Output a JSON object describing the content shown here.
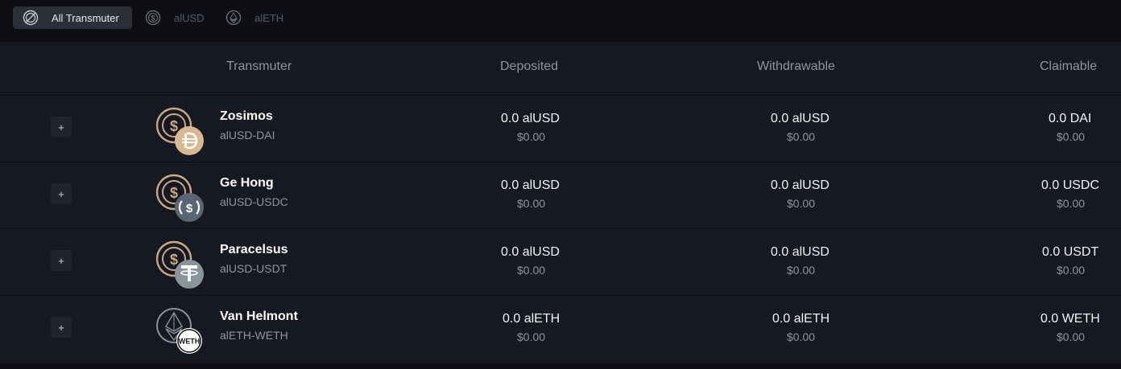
{
  "tabs": [
    {
      "label": "All Transmuter",
      "active": true,
      "icon": "transmuter-icon"
    },
    {
      "label": "alUSD",
      "active": false,
      "icon": "alusd-icon"
    },
    {
      "label": "alETH",
      "active": false,
      "icon": "aleth-icon"
    }
  ],
  "table": {
    "headers": {
      "transmuter": "Transmuter",
      "deposited": "Deposited",
      "withdrawable": "Withdrawable",
      "claimable": "Claimable"
    },
    "expand_label": "+",
    "rows": [
      {
        "name": "Zosimos",
        "pair": "alUSD-DAI",
        "deposited": "0.0 alUSD",
        "deposited_usd": "$0.00",
        "withdrawable": "0.0 alUSD",
        "withdrawable_usd": "$0.00",
        "claimable": "0.0 DAI",
        "claimable_usd": "$0.00",
        "token_icon": "dai-icon"
      },
      {
        "name": "Ge Hong",
        "pair": "alUSD-USDC",
        "deposited": "0.0 alUSD",
        "deposited_usd": "$0.00",
        "withdrawable": "0.0 alUSD",
        "withdrawable_usd": "$0.00",
        "claimable": "0.0 USDC",
        "claimable_usd": "$0.00",
        "token_icon": "usdc-icon"
      },
      {
        "name": "Paracelsus",
        "pair": "alUSD-USDT",
        "deposited": "0.0 alUSD",
        "deposited_usd": "$0.00",
        "withdrawable": "0.0 alUSD",
        "withdrawable_usd": "$0.00",
        "claimable": "0.0 USDT",
        "claimable_usd": "$0.00",
        "token_icon": "usdt-icon"
      },
      {
        "name": "Van Helmont",
        "pair": "alETH-WETH",
        "deposited": "0.0 alETH",
        "deposited_usd": "$0.00",
        "withdrawable": "0.0 alETH",
        "withdrawable_usd": "$0.00",
        "claimable": "0.0 WETH",
        "claimable_usd": "$0.00",
        "token_icon": "weth-icon",
        "token_badge": "WETH"
      }
    ]
  },
  "colors": {
    "page_bg": "#0d0f14",
    "panel_bg": "#161921",
    "active_tab_bg": "#2a2f3a",
    "muted_text": "#8e949e",
    "alusd_gold": "#c9a886",
    "usdc_slate": "#5b6675",
    "usdt_gray": "#8a959b"
  }
}
